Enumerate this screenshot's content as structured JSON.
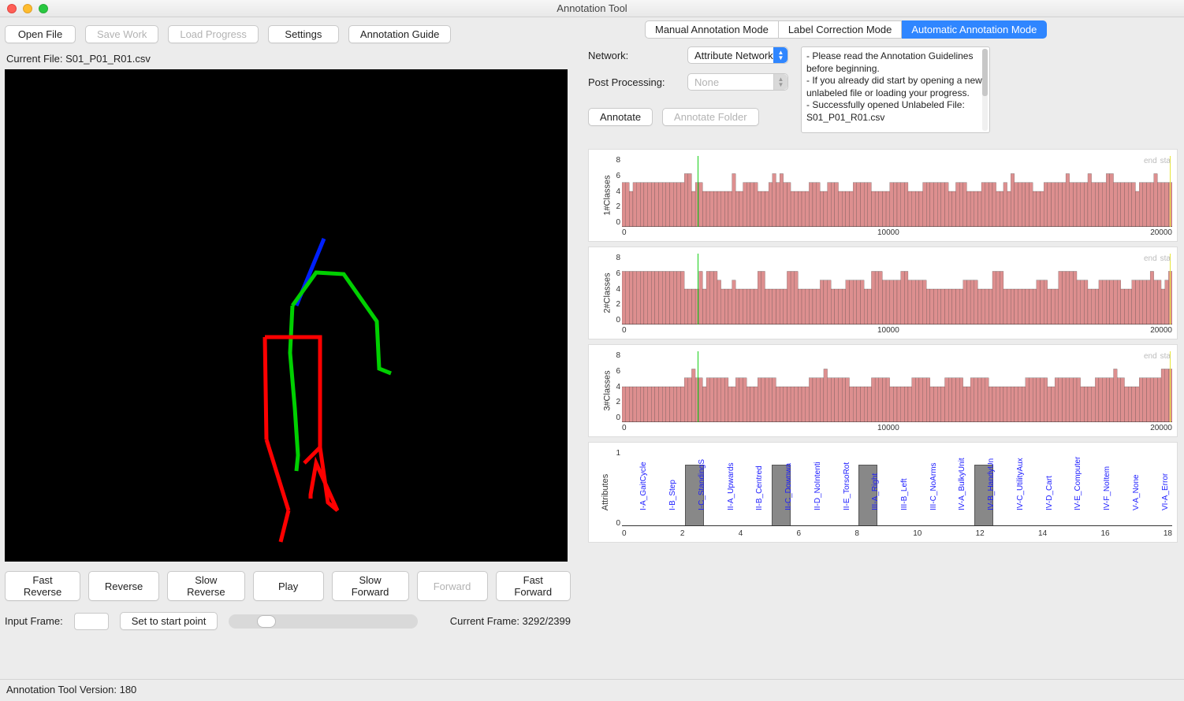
{
  "window": {
    "title": "Annotation Tool"
  },
  "toolbar": {
    "open": "Open File",
    "save": "Save Work",
    "load": "Load Progress",
    "settings": "Settings",
    "guide": "Annotation Guide"
  },
  "file_label_prefix": "Current File: ",
  "file_name": "S01_P01_R01.csv",
  "playback": {
    "fast_rev": "Fast Reverse",
    "rev": "Reverse",
    "slow_rev": "Slow Reverse",
    "play": "Play",
    "slow_fwd": "Slow Forward",
    "fwd": "Forward",
    "fast_fwd": "Fast Forward"
  },
  "frame": {
    "input_label": "Input Frame:",
    "set_btn": "Set to start point",
    "current_label": "Current Frame: 3292/2399"
  },
  "statusbar": "Annotation Tool Version: 180",
  "tabs": {
    "manual": "Manual Annotation Mode",
    "correction": "Label Correction Mode",
    "auto": "Automatic Annotation Mode"
  },
  "controls": {
    "network_label": "Network:",
    "network_value": "Attribute Network",
    "post_label": "Post Processing:",
    "post_value": "None",
    "annotate": "Annotate",
    "annotate_folder": "Annotate Folder"
  },
  "log_lines": [
    "- Please read the Annotation Guidelines before beginning.",
    "- If you already did start by opening a new unlabeled file or loading your progress.",
    "- Successfully opened Unlabeled File: S01_P01_R01.csv"
  ],
  "endtxt": {
    "end": "end",
    "sta": "sta"
  },
  "chart_data": [
    {
      "type": "bar",
      "ylabel": "1#Classes",
      "ylim": [
        0,
        8
      ],
      "xticks": [
        "0",
        "10000",
        "20000"
      ],
      "yticks": [
        "8",
        "6",
        "4",
        "2",
        "0"
      ],
      "marker_green_x_frac": 0.137,
      "marker_yellow_x_frac": 0.995,
      "values": [
        5,
        5,
        4,
        5,
        5,
        5,
        5,
        5,
        5,
        5,
        5,
        5,
        5,
        5,
        5,
        5,
        5,
        6,
        6,
        4,
        5,
        5,
        4,
        4,
        4,
        4,
        4,
        4,
        4,
        4,
        6,
        4,
        4,
        5,
        5,
        5,
        5,
        4,
        4,
        4,
        5,
        6,
        5,
        6,
        5,
        5,
        4,
        4,
        4,
        4,
        4,
        5,
        5,
        5,
        4,
        4,
        5,
        5,
        5,
        4,
        4,
        4,
        4,
        5,
        5,
        5,
        5,
        5,
        4,
        4,
        4,
        4,
        4,
        5,
        5,
        5,
        5,
        5,
        4,
        4,
        4,
        4,
        5,
        5,
        5,
        5,
        5,
        5,
        5,
        4,
        4,
        5,
        5,
        5,
        4,
        4,
        4,
        4,
        5,
        5,
        5,
        5,
        4,
        4,
        5,
        4,
        6,
        5,
        5,
        5,
        5,
        5,
        4,
        4,
        4,
        5,
        5,
        5,
        5,
        5,
        5,
        6,
        5,
        5,
        5,
        5,
        5,
        6,
        5,
        5,
        5,
        5,
        6,
        6,
        5,
        5,
        5,
        5,
        5,
        5,
        4,
        5,
        5,
        5,
        5,
        6,
        5,
        5,
        5,
        5
      ]
    },
    {
      "type": "bar",
      "ylabel": "2#Classes",
      "ylim": [
        0,
        8
      ],
      "xticks": [
        "0",
        "10000",
        "20000"
      ],
      "yticks": [
        "8",
        "6",
        "4",
        "2",
        "0"
      ],
      "marker_green_x_frac": 0.137,
      "marker_yellow_x_frac": 0.995,
      "values": [
        6,
        6,
        6,
        6,
        6,
        6,
        6,
        6,
        6,
        6,
        6,
        6,
        6,
        6,
        6,
        6,
        6,
        4,
        4,
        4,
        4,
        6,
        4,
        6,
        6,
        6,
        5,
        4,
        4,
        4,
        5,
        4,
        4,
        4,
        4,
        4,
        4,
        6,
        6,
        4,
        4,
        4,
        4,
        4,
        4,
        6,
        6,
        6,
        4,
        4,
        4,
        4,
        4,
        4,
        5,
        5,
        5,
        4,
        4,
        4,
        4,
        5,
        5,
        5,
        5,
        5,
        4,
        4,
        6,
        6,
        6,
        5,
        5,
        5,
        5,
        5,
        6,
        6,
        5,
        5,
        5,
        5,
        5,
        4,
        4,
        4,
        4,
        4,
        4,
        4,
        4,
        4,
        4,
        5,
        5,
        5,
        5,
        4,
        4,
        4,
        4,
        6,
        6,
        6,
        4,
        4,
        4,
        4,
        4,
        4,
        4,
        4,
        4,
        5,
        5,
        5,
        4,
        4,
        4,
        6,
        6,
        6,
        6,
        6,
        5,
        5,
        5,
        4,
        4,
        4,
        5,
        5,
        5,
        5,
        5,
        5,
        4,
        4,
        4,
        5,
        5,
        5,
        5,
        5,
        6,
        5,
        5,
        4,
        5,
        6
      ]
    },
    {
      "type": "bar",
      "ylabel": "3#Classes",
      "ylim": [
        0,
        8
      ],
      "xticks": [
        "0",
        "10000",
        "20000"
      ],
      "yticks": [
        "8",
        "6",
        "4",
        "2",
        "0"
      ],
      "marker_green_x_frac": 0.137,
      "marker_yellow_x_frac": 0.995,
      "values": [
        4,
        4,
        4,
        4,
        4,
        4,
        4,
        4,
        4,
        4,
        4,
        4,
        4,
        4,
        4,
        4,
        4,
        5,
        5,
        6,
        5,
        5,
        4,
        5,
        5,
        5,
        5,
        5,
        5,
        4,
        4,
        5,
        5,
        5,
        4,
        4,
        4,
        5,
        5,
        5,
        5,
        5,
        4,
        4,
        4,
        4,
        4,
        4,
        4,
        4,
        4,
        5,
        5,
        5,
        5,
        6,
        5,
        5,
        5,
        5,
        5,
        5,
        4,
        4,
        4,
        4,
        4,
        4,
        5,
        5,
        5,
        5,
        5,
        4,
        4,
        4,
        4,
        4,
        4,
        5,
        5,
        5,
        5,
        5,
        4,
        4,
        4,
        4,
        5,
        5,
        5,
        5,
        5,
        4,
        4,
        5,
        5,
        5,
        5,
        5,
        4,
        4,
        4,
        4,
        4,
        4,
        4,
        4,
        4,
        4,
        5,
        5,
        5,
        5,
        5,
        5,
        4,
        4,
        5,
        5,
        5,
        5,
        5,
        5,
        5,
        4,
        4,
        4,
        4,
        5,
        5,
        5,
        5,
        5,
        6,
        5,
        5,
        4,
        4,
        4,
        4,
        5,
        5,
        5,
        5,
        5,
        5,
        6,
        6,
        6
      ]
    },
    {
      "type": "bar",
      "ylabel": "Attributes",
      "ylim": [
        0,
        1
      ],
      "xticks": [
        "0",
        "2",
        "4",
        "6",
        "8",
        "10",
        "12",
        "14",
        "16",
        "18"
      ],
      "yticks": [
        "1",
        "0"
      ],
      "labels": [
        "I-A_GaitCycle",
        "I-B_Step",
        "I-C_StandingS",
        "II-A_Upwards",
        "II-B_Centred",
        "II-C_Downwa",
        "II-D_NoIntenti",
        "II-E_TorsoRot",
        "III-A_Right",
        "III-B_Left",
        "III-C_NoArms",
        "IV-A_BulkyUnit",
        "IV-B_HandyUn",
        "IV-C_UtilityAux",
        "IV-D_Cart",
        "IV-E_Computer",
        "IV-F_NoItem",
        "V-A_None",
        "VI-A_Error"
      ],
      "values": [
        0,
        0,
        1,
        0,
        0,
        1,
        0,
        0,
        1,
        0,
        0,
        0,
        1,
        0,
        0,
        0,
        0,
        0,
        0
      ]
    }
  ]
}
